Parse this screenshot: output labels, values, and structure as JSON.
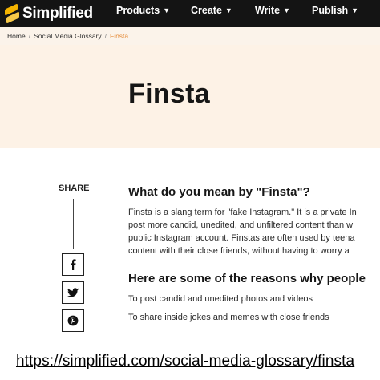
{
  "brand": {
    "name": "Simplified"
  },
  "nav": {
    "items": [
      {
        "label": "Products",
        "chevron": "chevron-down-icon"
      },
      {
        "label": "Create",
        "chevron": "chevron-down-icon"
      },
      {
        "label": "Write",
        "chevron": "chevron-down-icon"
      },
      {
        "label": "Publish",
        "chevron": "chevron-down-icon"
      }
    ]
  },
  "breadcrumb": {
    "items": [
      "Home",
      "Social Media Glossary",
      "Finsta"
    ],
    "separator": "/"
  },
  "hero": {
    "title": "Finsta"
  },
  "share": {
    "label": "SHARE",
    "buttons": [
      {
        "icon": "facebook-icon"
      },
      {
        "icon": "twitter-icon"
      },
      {
        "icon": "pinterest-icon"
      }
    ]
  },
  "article": {
    "heading1": "What do you mean by \"Finsta\"?",
    "paragraph_lines": [
      "Finsta is a slang term for \"fake Instagram.\" It is a private In",
      "post more candid, unedited, and unfiltered content than w",
      "public Instagram account. Finstas are often used by teena",
      "content with their close friends, without having to worry a"
    ],
    "heading2": "Here are some of the reasons why people",
    "reasons": [
      "To post candid and unedited photos and videos",
      "To share inside jokes and memes with close friends"
    ]
  },
  "caption": {
    "url": "https://simplified.com/social-media-glossary/finsta"
  },
  "colors": {
    "navbar": "#141414",
    "accent": "#e58a36",
    "hero_bg": "#fdf2e6",
    "logo": "#f5b400"
  }
}
